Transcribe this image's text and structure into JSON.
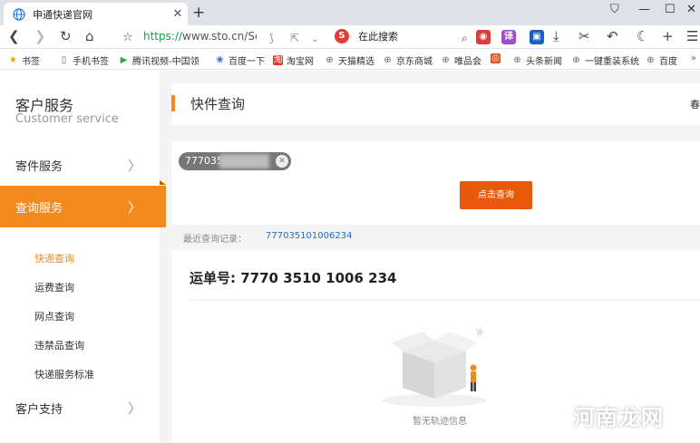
{
  "browser": {
    "tab_title": "申通快递官网",
    "url_scheme": "https://",
    "url_rest": "www.sto.cn/Sen",
    "search_placeholder": "在此搜索",
    "search_badge": "S",
    "translate_label": "译"
  },
  "bookmarks": [
    {
      "label": "书签",
      "icon": "star-icon"
    },
    {
      "label": "手机书签",
      "icon": "phone-icon"
    },
    {
      "label": "腾讯视频-中国领",
      "icon": "video-icon"
    },
    {
      "label": "百度一下",
      "icon": "baidu-paw-icon"
    },
    {
      "label": "淘宝网",
      "icon": "taobao-icon"
    },
    {
      "label": "天猫精选",
      "icon": "globe-icon"
    },
    {
      "label": "京东商城",
      "icon": "globe-icon"
    },
    {
      "label": "唯品会",
      "icon": "globe-icon"
    },
    {
      "label": "头条新闻",
      "icon": "globe-icon"
    },
    {
      "label": "一键重装系统",
      "icon": "globe-icon"
    },
    {
      "label": "百度",
      "icon": "globe-icon"
    }
  ],
  "sidebar": {
    "title": "客户服务",
    "subtitle": "Customer service",
    "items": [
      {
        "label": "寄件服务",
        "active": false
      },
      {
        "label": "查询服务",
        "active": true
      },
      {
        "label": "客户支持",
        "active": false
      }
    ],
    "sub_items": [
      {
        "label": "快递查询",
        "active": true
      },
      {
        "label": "运费查询",
        "active": false
      },
      {
        "label": "网点查询",
        "active": false
      },
      {
        "label": "违禁品查询",
        "active": false
      },
      {
        "label": "快递服务标准",
        "active": false
      }
    ]
  },
  "main": {
    "header_title": "快件查询",
    "header_right": "春",
    "chip_text": "777035",
    "query_button": "点击查询",
    "recent_label": "最近查询记录：",
    "recent_number": "777035101006234",
    "waybill": "运单号: 7770 3510 1006 234",
    "empty_text": "暂无轨迹信息"
  },
  "watermark": "河南龙网",
  "colors": {
    "accent": "#f28a1f",
    "button": "#e8590c",
    "link": "#2a6dbb"
  }
}
